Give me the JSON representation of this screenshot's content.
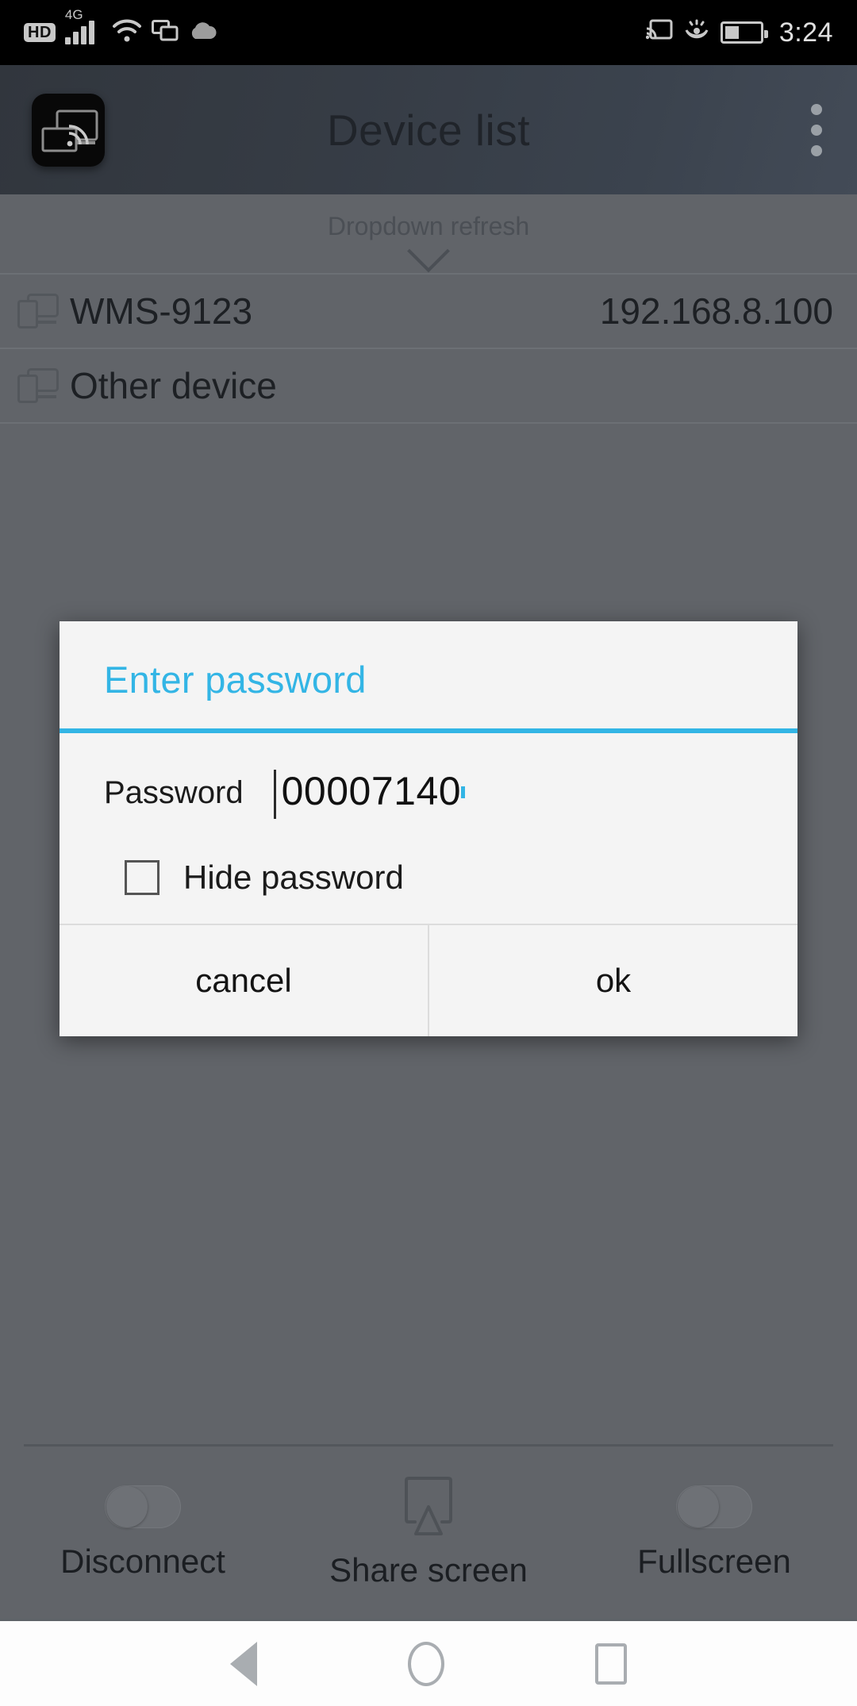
{
  "status_bar": {
    "hd_label": "HD",
    "network_label": "4G",
    "icons": [
      "hd-icon",
      "signal-icon",
      "wifi-icon",
      "screen-cast-alt-icon",
      "cloud-icon",
      "cast-icon",
      "eye-care-icon",
      "battery-icon"
    ],
    "time": "3:24"
  },
  "app_bar": {
    "title": "Device list",
    "app_icon": "screen-mirror-app-icon",
    "overflow_icon": "more-vertical-icon"
  },
  "list": {
    "refresh_hint": "Dropdown refresh",
    "refresh_chevron": "chevron-down-icon",
    "devices": [
      {
        "icon": "devices-icon",
        "name": "WMS-9123",
        "ip": "192.168.8.100"
      },
      {
        "icon": "devices-icon",
        "name": "Other device",
        "ip": ""
      }
    ]
  },
  "dialog": {
    "title": "Enter password",
    "accent_color": "#33B5E5",
    "password_label": "Password",
    "password_value": "00007140",
    "password_placeholder": "",
    "hide_password_label": "Hide password",
    "hide_password_checked": false,
    "cancel_label": "cancel",
    "ok_label": "ok"
  },
  "bottom_bar": {
    "items": [
      {
        "label": "Disconnect",
        "icon": "toggle-switch-off-icon",
        "state": "off"
      },
      {
        "label": "Share screen",
        "icon": "cast-screen-icon",
        "state": ""
      },
      {
        "label": "Fullscreen",
        "icon": "toggle-switch-off-icon",
        "state": "off"
      }
    ]
  },
  "nav_bar": {
    "back": "back-triangle-icon",
    "home": "home-circle-icon",
    "recents": "recents-square-icon"
  }
}
